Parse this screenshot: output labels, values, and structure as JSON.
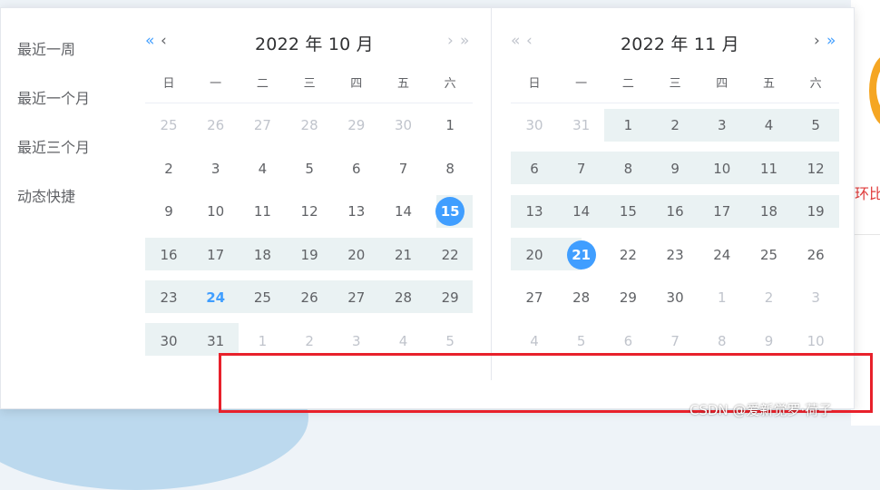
{
  "background": {
    "side_text": "环比"
  },
  "shortcuts": [
    "最近一周",
    "最近一个月",
    "最近三个月",
    "动态快捷"
  ],
  "weekdays": [
    "日",
    "一",
    "二",
    "三",
    "四",
    "五",
    "六"
  ],
  "left_panel": {
    "title": "2022 年 10 月",
    "prev_year": "«",
    "prev_month": "‹",
    "next_month": "›",
    "next_year": "»",
    "weeks": [
      [
        "25",
        "26",
        "27",
        "28",
        "29",
        "30",
        "1"
      ],
      [
        "2",
        "3",
        "4",
        "5",
        "6",
        "7",
        "8"
      ],
      [
        "9",
        "10",
        "11",
        "12",
        "13",
        "14",
        "15"
      ],
      [
        "16",
        "17",
        "18",
        "19",
        "20",
        "21",
        "22"
      ],
      [
        "23",
        "24",
        "25",
        "26",
        "27",
        "28",
        "29"
      ],
      [
        "30",
        "31",
        "1",
        "2",
        "3",
        "4",
        "5"
      ]
    ]
  },
  "right_panel": {
    "title": "2022 年 11 月",
    "prev_year": "«",
    "prev_month": "‹",
    "next_month": "›",
    "next_year": "»",
    "weeks": [
      [
        "30",
        "31",
        "1",
        "2",
        "3",
        "4",
        "5"
      ],
      [
        "6",
        "7",
        "8",
        "9",
        "10",
        "11",
        "12"
      ],
      [
        "13",
        "14",
        "15",
        "16",
        "17",
        "18",
        "19"
      ],
      [
        "20",
        "21",
        "22",
        "23",
        "24",
        "25",
        "26"
      ],
      [
        "27",
        "28",
        "29",
        "30",
        "1",
        "2",
        "3"
      ],
      [
        "4",
        "5",
        "6",
        "7",
        "8",
        "9",
        "10"
      ]
    ]
  },
  "selection": {
    "start": "2022-10-15",
    "end": "2022-11-21",
    "today": "2022-10-24"
  },
  "colors": {
    "accent": "#409eff",
    "range_bg": "#eaf2f3",
    "highlight_box": "#e8212b",
    "muted_text": "#c0c4cc"
  },
  "watermark": "CSDN @爱新觉罗·荷子"
}
